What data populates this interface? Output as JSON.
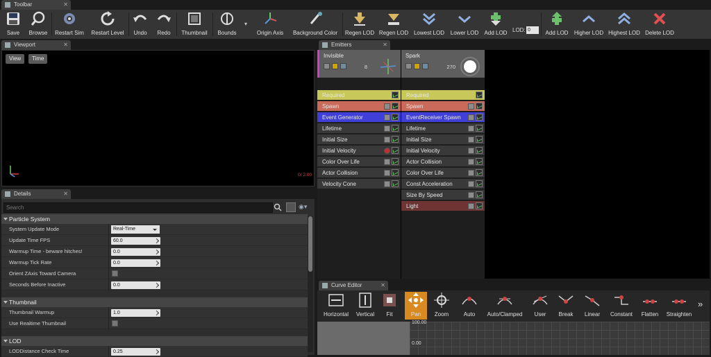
{
  "toolbar": {
    "tab_label": "Toolbar",
    "buttons": [
      {
        "label": "Save",
        "icon": "save-icon"
      },
      {
        "label": "Browse",
        "icon": "browse-icon"
      },
      {
        "label": "Restart Sim",
        "icon": "restart-sim-icon"
      },
      {
        "label": "Restart Level",
        "icon": "restart-level-icon"
      },
      {
        "label": "Undo",
        "icon": "undo-icon"
      },
      {
        "label": "Redo",
        "icon": "redo-icon"
      },
      {
        "label": "Thumbnail",
        "icon": "thumbnail-icon"
      },
      {
        "label": "Bounds",
        "icon": "bounds-icon"
      },
      {
        "label": "Origin Axis",
        "icon": "origin-axis-icon"
      },
      {
        "label": "Background Color",
        "icon": "background-color-icon"
      },
      {
        "label": "Regen LOD",
        "icon": "regen-lod-icon"
      },
      {
        "label": "Regen LOD",
        "icon": "regen-lod-icon"
      },
      {
        "label": "Lowest LOD",
        "icon": "lowest-lod-icon"
      },
      {
        "label": "Lower LOD",
        "icon": "lower-lod-icon"
      },
      {
        "label": "Add LOD",
        "icon": "add-lod-icon"
      },
      {
        "label": "Add LOD",
        "icon": "add-lod-icon"
      },
      {
        "label": "Higher LOD",
        "icon": "higher-lod-icon"
      },
      {
        "label": "Highest LOD",
        "icon": "highest-lod-icon"
      },
      {
        "label": "Delete LOD",
        "icon": "delete-lod-icon"
      }
    ],
    "lod_label": "LOD:",
    "lod_value": "0"
  },
  "viewport": {
    "tab_label": "Viewport",
    "view_button": "View",
    "time_button": "Time",
    "stats": "0/ 2.00"
  },
  "details": {
    "tab_label": "Details",
    "search_placeholder": "Search",
    "categories": [
      {
        "title": "Particle System",
        "rows": [
          {
            "name": "System Update Mode",
            "value": "Real-Time",
            "kind": "select"
          },
          {
            "name": "Update Time FPS",
            "value": "60.0",
            "kind": "number"
          },
          {
            "name": "Warmup Time - beware hitches!",
            "value": "0.0",
            "kind": "number"
          },
          {
            "name": "Warmup Tick Rate",
            "value": "0.0",
            "kind": "number"
          },
          {
            "name": "Orient ZAxis Toward Camera",
            "value": "",
            "kind": "check"
          },
          {
            "name": "Seconds Before Inactive",
            "value": "0.0",
            "kind": "number"
          }
        ]
      },
      {
        "title": "Thumbnail",
        "rows": [
          {
            "name": "Thumbnail Warmup",
            "value": "1.0",
            "kind": "number"
          },
          {
            "name": "Use Realtime Thumbnail",
            "value": "",
            "kind": "check"
          }
        ]
      },
      {
        "title": "LOD",
        "rows": [
          {
            "name": "LODDistance Check Time",
            "value": "0.25",
            "kind": "number"
          }
        ]
      }
    ]
  },
  "emitters": {
    "tab_label": "Emitters",
    "columns": [
      {
        "name": "Invisible",
        "count": "8",
        "modules": [
          {
            "label": "Required",
            "color": "#c8c85a"
          },
          {
            "label": "Spawn",
            "color": "#c96a5a"
          },
          {
            "label": "Event Generator",
            "color": "#4040d8"
          },
          {
            "label": "Lifetime",
            "color": "#393939"
          },
          {
            "label": "Initial Size",
            "color": "#393939"
          },
          {
            "label": "Initial Velocity",
            "color": "#393939"
          },
          {
            "label": "Color Over Life",
            "color": "#393939"
          },
          {
            "label": "Actor Collision",
            "color": "#393939"
          },
          {
            "label": "Velocity Cone",
            "color": "#393939"
          }
        ]
      },
      {
        "name": "Spark",
        "count": "270",
        "modules": [
          {
            "label": "Required",
            "color": "#c8c85a"
          },
          {
            "label": "Spawn",
            "color": "#c96a5a"
          },
          {
            "label": "EventReceiver Spawn",
            "color": "#4040d8"
          },
          {
            "label": "Lifetime",
            "color": "#393939"
          },
          {
            "label": "Initial Size",
            "color": "#393939"
          },
          {
            "label": "Initial Velocity",
            "color": "#393939"
          },
          {
            "label": "Actor Collision",
            "color": "#393939"
          },
          {
            "label": "Color Over Life",
            "color": "#393939"
          },
          {
            "label": "Const Acceleration",
            "color": "#393939"
          },
          {
            "label": "Size By Speed",
            "color": "#393939"
          },
          {
            "label": "Light",
            "color": "#6e3434"
          }
        ]
      }
    ]
  },
  "curve_editor": {
    "tab_label": "Curve Editor",
    "buttons": [
      {
        "label": "Horizontal",
        "icon": "horizontal-icon"
      },
      {
        "label": "Vertical",
        "icon": "vertical-icon"
      },
      {
        "label": "Fit",
        "icon": "fit-icon"
      },
      {
        "label": "Pan",
        "icon": "pan-icon"
      },
      {
        "label": "Zoom",
        "icon": "zoom-icon"
      },
      {
        "label": "Auto",
        "icon": "auto-icon"
      },
      {
        "label": "Auto/Clamped",
        "icon": "auto-clamped-icon"
      },
      {
        "label": "User",
        "icon": "user-icon"
      },
      {
        "label": "Break",
        "icon": "break-icon"
      },
      {
        "label": "Linear",
        "icon": "linear-icon"
      },
      {
        "label": "Constant",
        "icon": "constant-icon"
      },
      {
        "label": "Flatten",
        "icon": "flatten-icon"
      },
      {
        "label": "Straighten",
        "icon": "straighten-icon"
      }
    ],
    "more": "»",
    "axis_top": "100.00",
    "axis_zero": "0.00"
  }
}
